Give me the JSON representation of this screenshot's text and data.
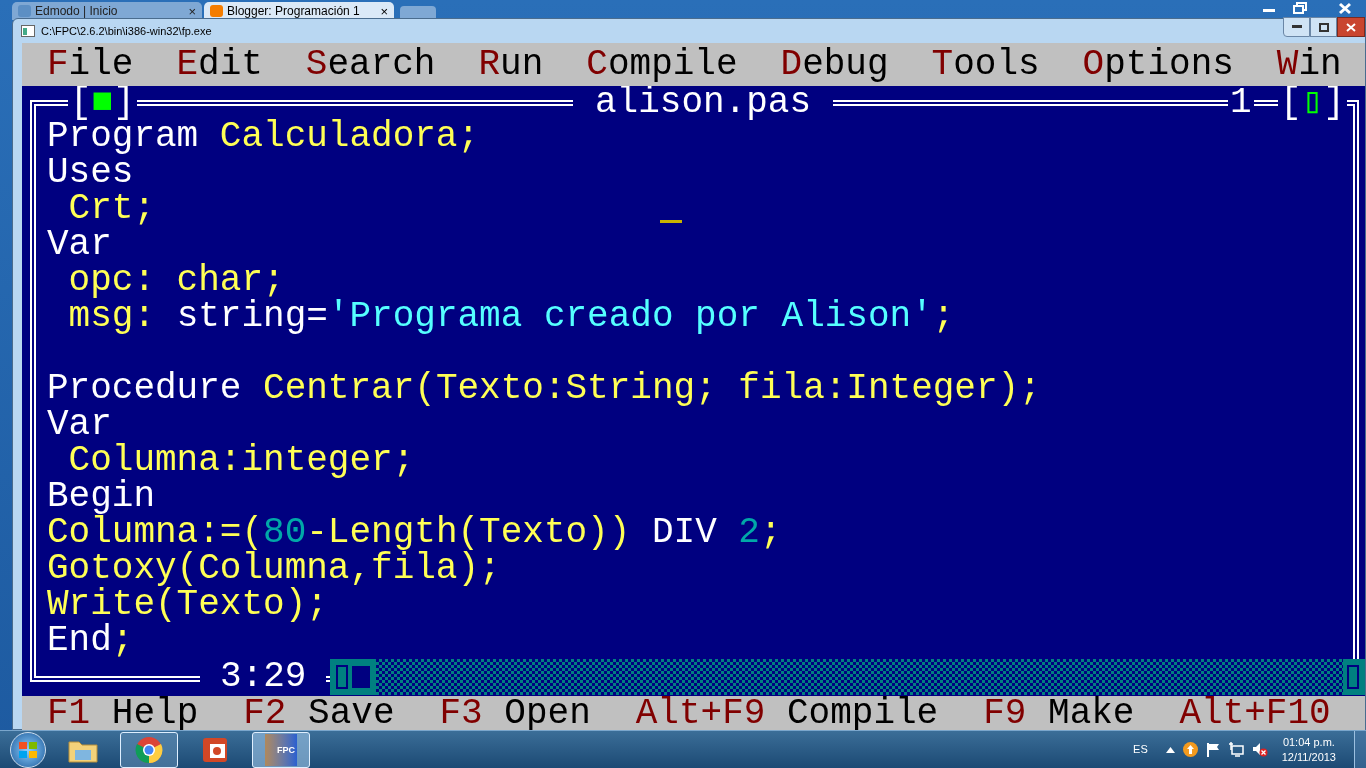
{
  "browser": {
    "tabs": [
      {
        "title": "Edmodo | Inicio",
        "close": "×",
        "selected": false
      },
      {
        "title": "Blogger: Programación 1",
        "close": "×",
        "selected": true
      }
    ]
  },
  "window": {
    "title": "C:\\FPC\\2.6.2\\bin\\i386-win32\\fp.exe"
  },
  "menu": [
    "File",
    "Edit",
    "Search",
    "Run",
    "Compile",
    "Debug",
    "Tools",
    "Options",
    "Win"
  ],
  "editor": {
    "close_button": "[■]",
    "title": "alison.pas",
    "number": "1",
    "zoom_button": "[▯]",
    "position": "3:29",
    "lines": [
      {
        "kind": "code",
        "segments": [
          {
            "text": "Program ",
            "kind": "keyword"
          },
          {
            "text": "Calculadora;",
            "kind": "identifier"
          }
        ]
      },
      {
        "kind": "code",
        "segments": [
          {
            "text": "Uses",
            "kind": "keyword"
          }
        ]
      },
      {
        "kind": "code",
        "segments": [
          {
            "text": " Crt;",
            "kind": "identifier"
          }
        ]
      },
      {
        "kind": "code",
        "segments": [
          {
            "text": "Var",
            "kind": "keyword"
          }
        ]
      },
      {
        "kind": "code",
        "segments": [
          {
            "text": " opc: char;",
            "kind": "identifier"
          }
        ]
      },
      {
        "kind": "code",
        "segments": [
          {
            "text": " msg: ",
            "kind": "identifier"
          },
          {
            "text": "string=",
            "kind": "keyword"
          },
          {
            "text": "'Programa creado por Alison'",
            "kind": "string"
          },
          {
            "text": ";",
            "kind": "identifier"
          }
        ]
      },
      {
        "kind": "blank"
      },
      {
        "kind": "code",
        "segments": [
          {
            "text": "Procedure ",
            "kind": "keyword"
          },
          {
            "text": "Centrar(Texto:String; fila:Integer);",
            "kind": "identifier"
          }
        ]
      },
      {
        "kind": "code",
        "segments": [
          {
            "text": "Var",
            "kind": "keyword"
          }
        ]
      },
      {
        "kind": "code",
        "segments": [
          {
            "text": " Columna:integer;",
            "kind": "identifier"
          }
        ]
      },
      {
        "kind": "code",
        "segments": [
          {
            "text": "Begin",
            "kind": "keyword"
          }
        ]
      },
      {
        "kind": "code",
        "segments": [
          {
            "text": "Columna:=(",
            "kind": "identifier"
          },
          {
            "text": "80",
            "kind": "number"
          },
          {
            "text": "-Length(Texto)) ",
            "kind": "identifier"
          },
          {
            "text": "DIV ",
            "kind": "keyword"
          },
          {
            "text": "2",
            "kind": "number"
          },
          {
            "text": ";",
            "kind": "identifier"
          }
        ]
      },
      {
        "kind": "code",
        "segments": [
          {
            "text": "Gotoxy(Columna,fila);",
            "kind": "identifier"
          }
        ]
      },
      {
        "kind": "code",
        "segments": [
          {
            "text": "Write(Texto);",
            "kind": "identifier"
          }
        ]
      },
      {
        "kind": "code",
        "segments": [
          {
            "text": "End",
            "kind": "keyword"
          },
          {
            "text": ";",
            "kind": "identifier"
          }
        ]
      }
    ]
  },
  "status_bar": [
    {
      "key": "F1",
      "label": "Help"
    },
    {
      "key": "F2",
      "label": "Save"
    },
    {
      "key": "F3",
      "label": "Open"
    },
    {
      "key": "Alt+F9",
      "label": "Compile"
    },
    {
      "key": "F9",
      "label": "Make"
    },
    {
      "key": "Alt+F10"
    }
  ],
  "taskbar": {
    "apps": [
      {
        "kind": "folder",
        "selected": false,
        "running": false
      },
      {
        "kind": "chrome",
        "selected": false,
        "running": true
      },
      {
        "kind": "powerpoint",
        "selected": false,
        "running": false
      },
      {
        "kind": "fpc",
        "selected": true,
        "running": true,
        "badge": "FPC"
      }
    ],
    "language": "ES",
    "time": "01:04 p.m.",
    "date": "12/11/2013"
  }
}
